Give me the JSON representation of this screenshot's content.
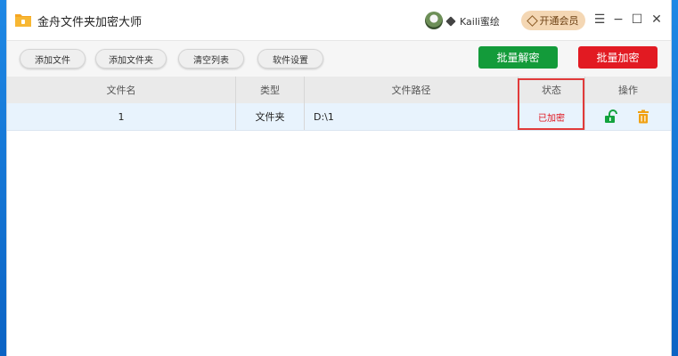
{
  "app": {
    "title": "金舟文件夹加密大师"
  },
  "user": {
    "name": "Kaili蜜绘",
    "vip_label": "开通会员"
  },
  "window_controls": {
    "menu": "☰",
    "minimize": "−",
    "maximize": "☐",
    "close": "✕"
  },
  "toolbar": {
    "add_file": "添加文件",
    "add_folder": "添加文件夹",
    "clear_list": "清空列表",
    "settings": "软件设置",
    "batch_decrypt": "批量解密",
    "batch_encrypt": "批量加密"
  },
  "table": {
    "headers": {
      "filename": "文件名",
      "type": "类型",
      "path": "文件路径",
      "status": "状态",
      "actions": "操作"
    },
    "rows": [
      {
        "filename": "1",
        "type": "文件夹",
        "path": "D:\\1",
        "status": "已加密"
      }
    ]
  },
  "colors": {
    "status_encrypted": "#e0141e",
    "decrypt_btn": "#139b3a",
    "encrypt_btn": "#e21a22",
    "unlock_icon": "#13a33e",
    "delete_icon": "#f0a113"
  },
  "icons": {
    "unlock": "unlock-icon",
    "delete": "trash-icon"
  }
}
